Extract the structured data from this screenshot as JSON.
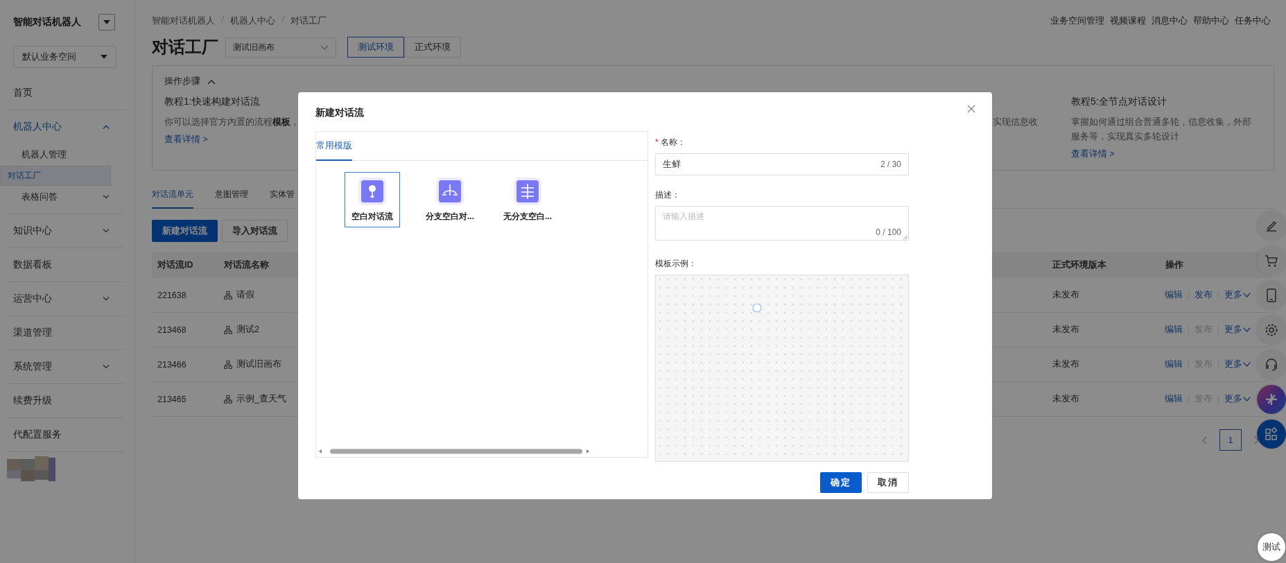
{
  "sidebar": {
    "title": "智能对话机器人",
    "workspace": "默认业务空间",
    "items": [
      {
        "label": "首页",
        "selected": false
      },
      {
        "label": "机器人中心",
        "expanded": true,
        "selected": false,
        "children": [
          {
            "label": "机器人管理",
            "selected": false
          },
          {
            "label": "对话工厂",
            "selected": true
          },
          {
            "label": "表格问答",
            "expanded": false,
            "selected": false
          }
        ]
      },
      {
        "label": "知识中心",
        "expanded": false,
        "selected": false
      },
      {
        "label": "数据看板",
        "selected": false
      },
      {
        "label": "运营中心",
        "expanded": false,
        "selected": false
      },
      {
        "label": "渠道管理",
        "selected": false
      },
      {
        "label": "系统管理",
        "expanded": false,
        "selected": false
      },
      {
        "label": "续费升级",
        "selected": false
      },
      {
        "label": "代配置服务",
        "selected": false
      }
    ]
  },
  "breadcrumb": [
    "智能对话机器人",
    "机器人中心",
    "对话工厂"
  ],
  "top_links": [
    "业务空间管理",
    "视频课程",
    "消息中心",
    "帮助中心",
    "任务中心"
  ],
  "page_title": "对话工厂",
  "canvas_select": "测试旧画布",
  "environments": [
    {
      "label": "测试环境",
      "selected": true
    },
    {
      "label": "正式环境",
      "selected": false
    }
  ],
  "steps": {
    "title": "操作步骤",
    "expanded": true,
    "tutorials": [
      {
        "title": "教程1:快速构建对话流",
        "desc": "你可以选择官方内置的流程**模板**，",
        "link": "查看详情 >"
      },
      {
        "desc": "实现信息收"
      },
      {
        "title": "教程5:全节点对话设计",
        "desc": "掌握如何通过组合普通多轮，信息收集，外部服务等，实现真实多轮设计",
        "link": "查看详情 >"
      }
    ]
  },
  "tabs": [
    {
      "label": "对话流单元",
      "selected": true
    },
    {
      "label": "意图管理",
      "selected": false
    },
    {
      "label": "实体管",
      "selected": false
    }
  ],
  "toolbar": [
    {
      "label": "新建对话流",
      "kind": "primary"
    },
    {
      "label": "导入对话流",
      "kind": "default"
    }
  ],
  "table": {
    "columns": [
      "对话流ID",
      "对话流名称",
      "正式环境版本",
      "操作"
    ],
    "rows": [
      {
        "id": "221638",
        "name": "请假",
        "status": "未发布",
        "actions": [
          {
            "label": "编辑",
            "disabled": false
          },
          {
            "label": "发布",
            "disabled": false
          },
          {
            "label": "更多",
            "disabled": false
          }
        ]
      },
      {
        "id": "213468",
        "name": "测试2",
        "status": "未发布",
        "actions": [
          {
            "label": "编辑",
            "disabled": false
          },
          {
            "label": "发布",
            "disabled": true
          },
          {
            "label": "更多",
            "disabled": false
          }
        ]
      },
      {
        "id": "213466",
        "name": "测试旧画布",
        "status": "未发布",
        "actions": [
          {
            "label": "编辑",
            "disabled": false
          },
          {
            "label": "发布",
            "disabled": true
          },
          {
            "label": "更多",
            "disabled": false
          }
        ]
      },
      {
        "id": "213465",
        "name": "示例_查天气",
        "status": "未发布",
        "actions": [
          {
            "label": "编辑",
            "disabled": false
          },
          {
            "label": "发布",
            "disabled": true
          },
          {
            "label": "更多",
            "disabled": false
          }
        ]
      }
    ]
  },
  "pagination": {
    "pages": [
      {
        "label": "1",
        "selected": true
      }
    ]
  },
  "test_button": "测试",
  "dialog": {
    "title": "新建对话流",
    "template_tab": "常用模版",
    "templates": [
      {
        "label": "空白对话流",
        "kind": "blank",
        "selected": true
      },
      {
        "label": "分支空白对...",
        "kind": "branch",
        "selected": false
      },
      {
        "label": "无分支空白...",
        "kind": "linear",
        "selected": false
      }
    ],
    "name_label": "名称：",
    "name_required_mark": "*",
    "name_value": "生鲜",
    "name_count": "2 / 30",
    "desc_label": "描述：",
    "desc_placeholder": "请输入描述",
    "desc_count": "0 / 100",
    "example_label": "模板示例：",
    "buttons": [
      {
        "label": "确定",
        "kind": "primary"
      },
      {
        "label": "取消",
        "kind": "default"
      }
    ]
  }
}
